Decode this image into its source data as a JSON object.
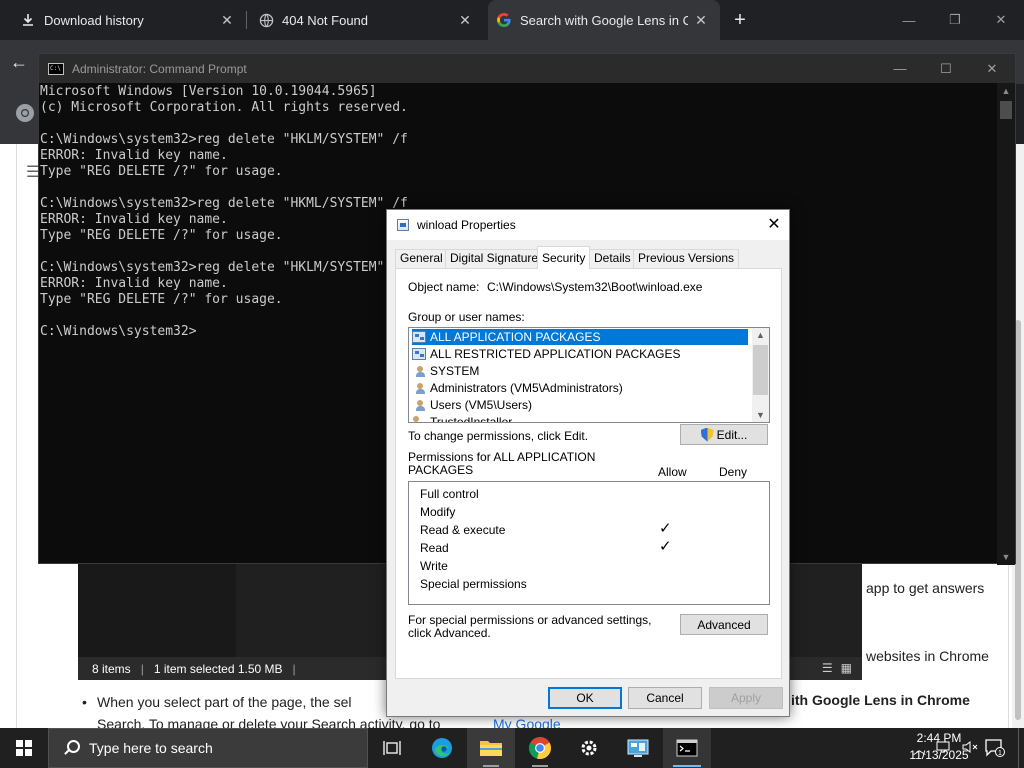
{
  "browser": {
    "tabs": [
      {
        "title": "Download history",
        "icon": "download-icon"
      },
      {
        "title": "404 Not Found",
        "icon": "globe-icon"
      },
      {
        "title": "Search with Google Lens in Chr",
        "icon": "google-g-icon",
        "active": true
      }
    ],
    "new_tab_symbol": "+"
  },
  "webpage": {
    "snippet_right_1": "app to get answers",
    "snippet_right_2": "websites in Chrome",
    "snippet_right_bold": "ith Google Lens in Chrome",
    "bullet": "•",
    "line_1": "When you select part of the page, the sel",
    "line_2": "Search. To manage or delete your Search activity, go to",
    "link": "My Google",
    "line_partial": "p"
  },
  "explorer": {
    "items": "8 items",
    "selected": "1 item selected  1.50 MB",
    "separator": "|"
  },
  "cmd": {
    "title": "Administrator: Command Prompt",
    "icon_text": "C:\\",
    "lines": [
      "Microsoft Windows [Version 10.0.19044.5965]",
      "(c) Microsoft Corporation. All rights reserved.",
      "",
      "C:\\Windows\\system32>reg delete \"HKLM/SYSTEM\" /f",
      "ERROR: Invalid key name.",
      "Type \"REG DELETE /?\" for usage.",
      "",
      "C:\\Windows\\system32>reg delete \"HKML/SYSTEM\" /f",
      "ERROR: Invalid key name.",
      "Type \"REG DELETE /?\" for usage.",
      "",
      "C:\\Windows\\system32>reg delete \"HKLM/SYSTEM\"",
      "ERROR: Invalid key name.",
      "Type \"REG DELETE /?\" for usage.",
      "",
      "C:\\Windows\\system32>"
    ]
  },
  "dialog": {
    "title": "winload Properties",
    "tabs": [
      "General",
      "Digital Signatures",
      "Security",
      "Details",
      "Previous Versions"
    ],
    "active_tab": "Security",
    "object_label": "Object name:",
    "object_value": "C:\\Windows\\System32\\Boot\\winload.exe",
    "groups_label": "Group or user names:",
    "groups": [
      {
        "name": "ALL APPLICATION PACKAGES",
        "icon": "package-icon",
        "selected": true
      },
      {
        "name": "ALL RESTRICTED APPLICATION PACKAGES",
        "icon": "package-icon"
      },
      {
        "name": "SYSTEM",
        "icon": "users-icon"
      },
      {
        "name": "Administrators (VM5\\Administrators)",
        "icon": "users-icon"
      },
      {
        "name": "Users (VM5\\Users)",
        "icon": "users-icon"
      },
      {
        "name": "TrustedInstaller",
        "icon": "user-icon"
      }
    ],
    "change_text": "To change permissions, click Edit.",
    "edit_label": "Edit...",
    "perm_label": "Permissions for ALL APPLICATION PACKAGES",
    "allow": "Allow",
    "deny": "Deny",
    "permissions": [
      {
        "name": "Full control",
        "allow": false
      },
      {
        "name": "Modify",
        "allow": false
      },
      {
        "name": "Read & execute",
        "allow": true
      },
      {
        "name": "Read",
        "allow": true
      },
      {
        "name": "Write",
        "allow": false
      },
      {
        "name": "Special permissions",
        "allow": false
      }
    ],
    "check_mark": "✓",
    "special_text": "For special permissions or advanced settings, click Advanced.",
    "advanced_label": "Advanced",
    "ok": "OK",
    "cancel": "Cancel",
    "apply": "Apply"
  },
  "taskbar": {
    "search_placeholder": "Type here to search",
    "time": "2:44 PM",
    "date": "11/13/2025",
    "notification_count": "1"
  },
  "colors": {
    "accent": "#0078d7",
    "cmd_bg": "#0c0c0c",
    "taskbar_bg": "#202020",
    "chrome_bg": "#202124"
  }
}
